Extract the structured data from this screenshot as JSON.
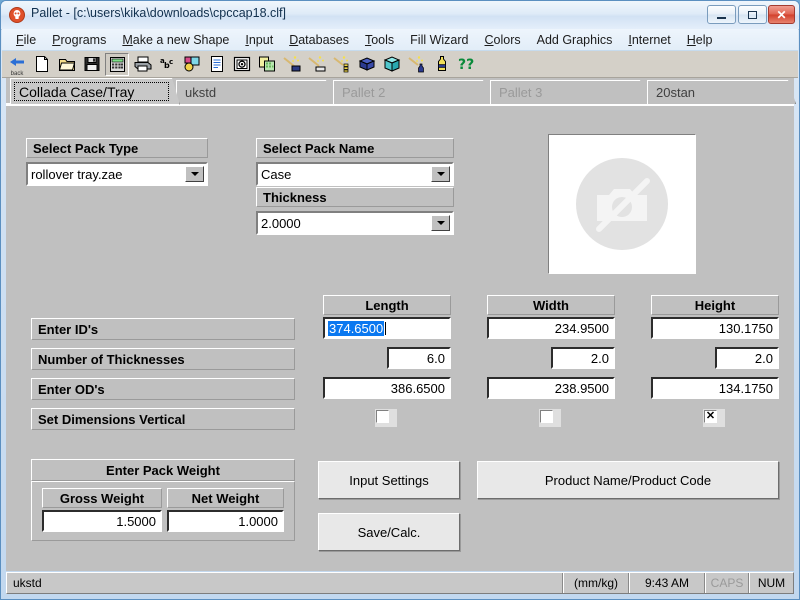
{
  "window": {
    "title": "Pallet - [c:\\users\\kika\\downloads\\cpccap18.clf]",
    "app_icon": "pallet-app-icon",
    "minimize_label": "Minimize",
    "maximize_label": "Maximize",
    "close_label": "✕"
  },
  "menubar": {
    "items": [
      {
        "pre": "",
        "mn": "F",
        "post": "ile"
      },
      {
        "pre": "",
        "mn": "P",
        "post": "rograms"
      },
      {
        "pre": "",
        "mn": "M",
        "post": "ake a new Shape"
      },
      {
        "pre": "",
        "mn": "I",
        "post": "nput"
      },
      {
        "pre": "",
        "mn": "D",
        "post": "atabases"
      },
      {
        "pre": "",
        "mn": "T",
        "post": "ools"
      },
      {
        "pre": "Fill Wizard",
        "mn": "",
        "post": ""
      },
      {
        "pre": "",
        "mn": "C",
        "post": "olors"
      },
      {
        "pre": "Add Graphics",
        "mn": "",
        "post": ""
      },
      {
        "pre": "",
        "mn": "I",
        "post": "nternet"
      },
      {
        "pre": "",
        "mn": "H",
        "post": "elp"
      }
    ]
  },
  "toolbar": {
    "buttons": [
      {
        "name": "back-icon",
        "label": "back"
      },
      {
        "name": "new-file-icon",
        "label": ""
      },
      {
        "name": "open-folder-icon",
        "label": ""
      },
      {
        "name": "save-disk-icon",
        "label": ""
      },
      {
        "name": "calculator-icon",
        "label": ""
      },
      {
        "name": "print-icon",
        "label": ""
      },
      {
        "name": "abc-spellcheck-icon",
        "label": ""
      },
      {
        "name": "shapes-color-icon",
        "label": ""
      },
      {
        "name": "document-properties-icon",
        "label": ""
      },
      {
        "name": "camera-photo-icon",
        "label": ""
      },
      {
        "name": "copy-pages-icon",
        "label": ""
      },
      {
        "name": "wand-case-icon",
        "label": ""
      },
      {
        "name": "wand-tray-icon",
        "label": ""
      },
      {
        "name": "wand-stack-icon",
        "label": ""
      },
      {
        "name": "blue-box-icon",
        "label": ""
      },
      {
        "name": "cyan-crate-icon",
        "label": ""
      },
      {
        "name": "wand-bottle-icon",
        "label": ""
      },
      {
        "name": "bottle-icon",
        "label": ""
      },
      {
        "name": "help-question-icon",
        "label": ""
      }
    ]
  },
  "tabs": [
    {
      "label": "Collada Case/Tray",
      "state": "active"
    },
    {
      "label": "ukstd",
      "state": "normal"
    },
    {
      "label": "Pallet 2",
      "state": "disabled"
    },
    {
      "label": "Pallet 3",
      "state": "disabled"
    },
    {
      "label": "20stan",
      "state": "normal"
    }
  ],
  "form": {
    "pack_type": {
      "label": "Select Pack Type",
      "value": "rollover tray.zae"
    },
    "pack_name": {
      "label": "Select Pack Name",
      "value": "Case",
      "selected": true
    },
    "thickness": {
      "label": "Thickness",
      "value": "2.0000"
    },
    "preview": {
      "alt": "no-image-placeholder"
    },
    "columns": [
      "Length",
      "Width",
      "Height"
    ],
    "rows": [
      {
        "label": "Enter ID's",
        "values": [
          "374.6500",
          "234.9500",
          "130.1750"
        ],
        "focused_cell": 0
      },
      {
        "label": "Number of Thicknesses",
        "values": [
          "6.0",
          "2.0",
          "2.0"
        ],
        "focused_cell": -1
      },
      {
        "label": "Enter OD's",
        "values": [
          "386.6500",
          "238.9500",
          "134.1750"
        ],
        "focused_cell": -1
      }
    ],
    "vertical_row": {
      "label": "Set Dimensions Vertical",
      "checked": [
        false,
        false,
        true
      ],
      "check_glyph": "✕"
    },
    "pack_weight": {
      "title": "Enter Pack Weight",
      "gross": {
        "label": "Gross Weight",
        "value": "1.5000"
      },
      "net": {
        "label": "Net Weight",
        "value": "1.0000"
      }
    },
    "buttons": {
      "input_settings": "Input Settings",
      "save_calc": "Save/Calc.",
      "product_name_code": "Product Name/Product Code"
    }
  },
  "statusbar": {
    "message": "ukstd",
    "units": "(mm/kg)",
    "time": "9:43 AM",
    "caps": "CAPS",
    "num": "NUM"
  },
  "colors": {
    "face": "#c0c0c0",
    "selection": "#0a78f0",
    "accent": "#d2402c",
    "disabled_text": "#9a9a9a"
  }
}
